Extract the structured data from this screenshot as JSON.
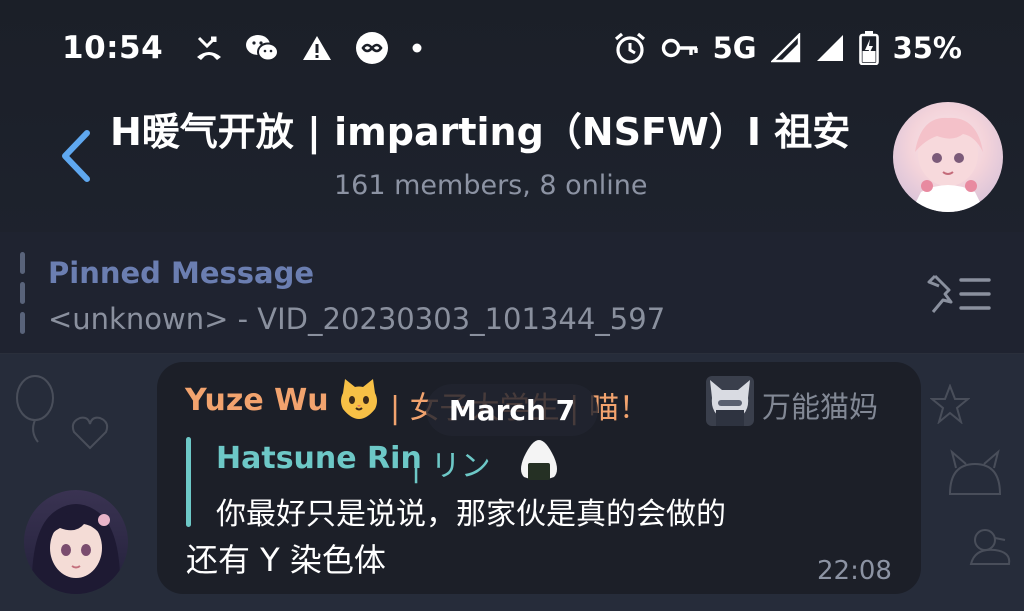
{
  "status_bar": {
    "time": "10:54",
    "network": "5G",
    "battery": "35%",
    "icons_left": [
      "missed-call-icon",
      "wechat-icon",
      "warning-icon",
      "infinity-app-icon",
      "dot-icon"
    ],
    "icons_right": [
      "alarm-icon",
      "key-icon",
      "signal-icon",
      "signal-icon",
      "battery-charging-icon"
    ]
  },
  "header": {
    "title": "H暖气开放 | imparting（NSFW）I 祖安",
    "subtitle": "161 members, 8 online"
  },
  "pinned": {
    "title": "Pinned Message",
    "text": "<unknown> - VID_20230303_101344_597"
  },
  "date_pill": "March 7",
  "message": {
    "sender_name": "Yuze Wu",
    "sender_rest": "| 女子大学生 | 喵！",
    "admin_title": "万能猫妈",
    "reply": {
      "name": "Hatsune Rin",
      "rest": "| リン",
      "text": "你最好只是说说，那家伙是真的会做的"
    },
    "text": "还有 Y 染色体",
    "time": "22:08"
  },
  "colors": {
    "background": "#1b1f28",
    "bubble": "#1c1f28",
    "sender": "#f2a36e",
    "reply_accent": "#6dc8c7",
    "pinned_title": "#6b7eb1",
    "back_arrow": "#5fa8f0",
    "muted": "#8c93a3"
  }
}
